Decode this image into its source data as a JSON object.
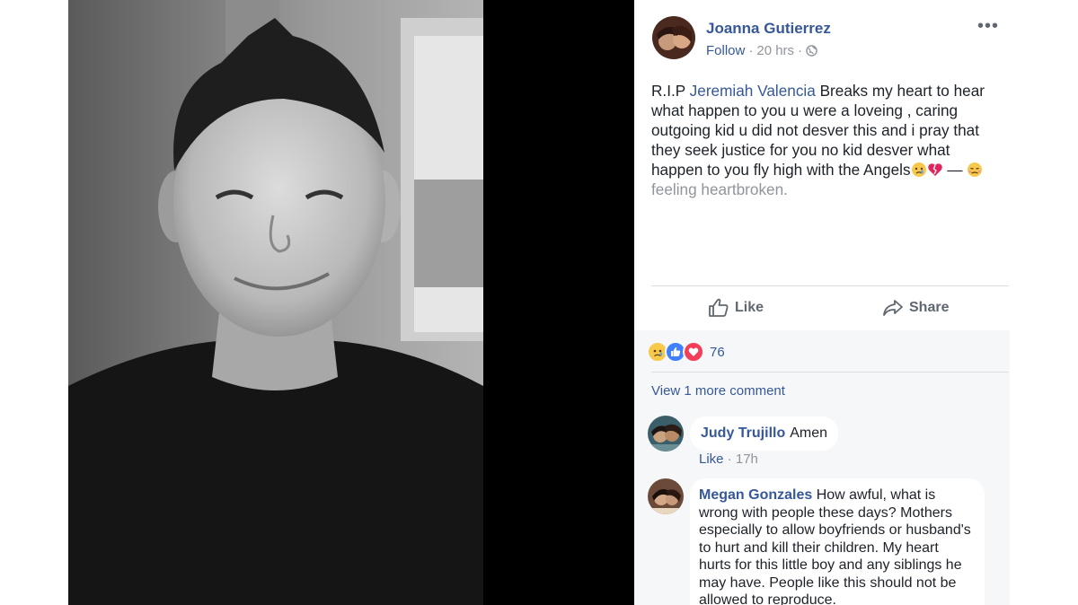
{
  "post": {
    "author": "Joanna Gutierrez",
    "follow": "Follow",
    "time": "20 hrs",
    "more": "•••",
    "text_intro": "R.I.P ",
    "tagged_person": "Jeremiah Valencia",
    "text_body": " Breaks my heart to hear what happen to you u were a loveing , caring outgoing kid u did not desver this and i pray that they seek justice for you no kid desver what happen to you fly high with the Angels",
    "dash": " —",
    "feeling": "feeling heartbroken."
  },
  "actions": {
    "like": "Like",
    "share": "Share"
  },
  "reactions": {
    "count": "76",
    "types": [
      "sad",
      "like",
      "love"
    ]
  },
  "comments": {
    "view_more": "View 1 more comment",
    "items": [
      {
        "name": "Judy Trujillo",
        "text": "Amen",
        "like": "Like",
        "time": "17h"
      },
      {
        "name": "Megan Gonzales",
        "text": "How awful, what is wrong with people these days? Mothers especially to allow boyfriends or husband's to hurt and kill their children. My heart hurts for this little boy and any siblings he may have. People like this should not be allowed to reproduce."
      }
    ]
  },
  "colors": {
    "link": "#365899",
    "text": "#1d2129",
    "muted": "#90949c",
    "viewer_bg": "#000000",
    "like_blue": "#4080ff",
    "love_red": "#f33e58"
  },
  "icons": [
    "globe-icon",
    "thumbs-up-icon",
    "share-arrow-icon",
    "more-options-icon",
    "sad-emoji-icon",
    "broken-heart-icon",
    "heartbroken-face-icon"
  ]
}
